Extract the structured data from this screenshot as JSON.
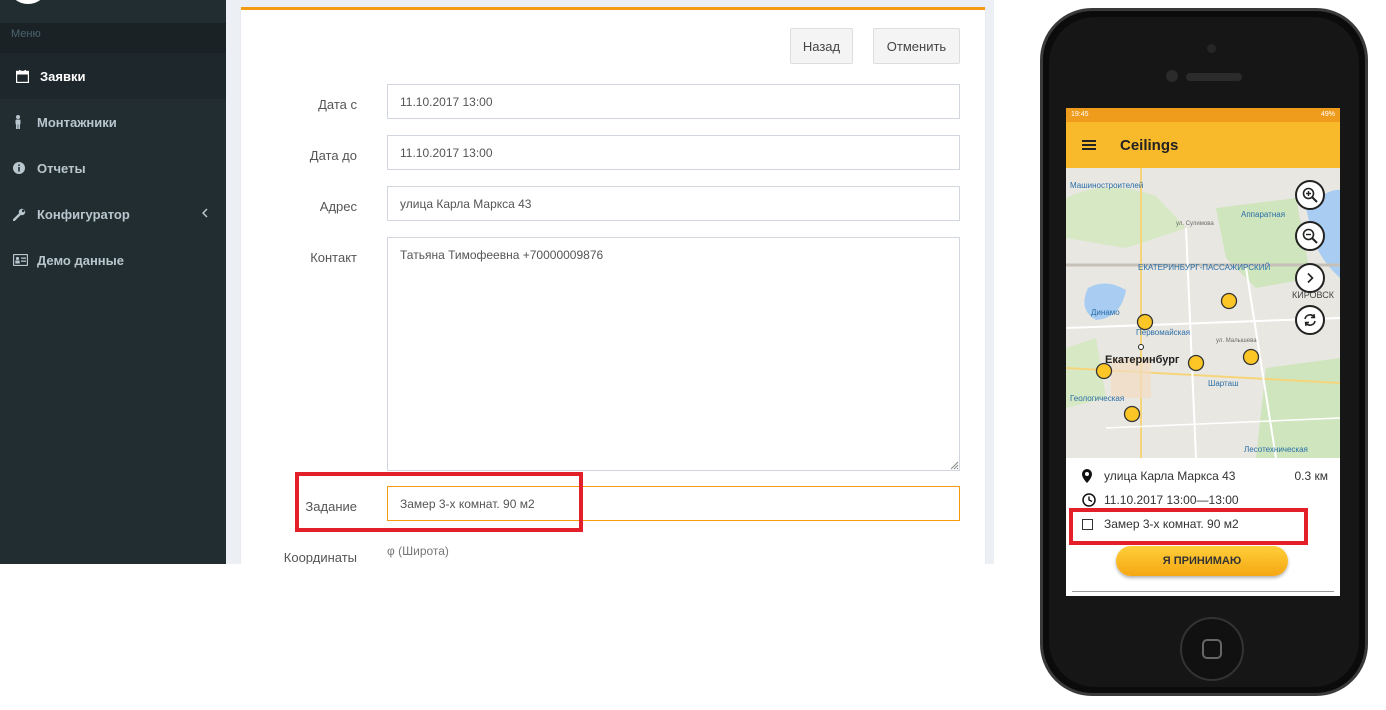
{
  "sidebar": {
    "header": "Меню",
    "items": [
      {
        "label": "Заявки",
        "icon": "calendar-icon"
      },
      {
        "label": "Монтажники",
        "icon": "person-icon"
      },
      {
        "label": "Отчеты",
        "icon": "info-icon"
      },
      {
        "label": "Конфигуратор",
        "icon": "wrench-icon"
      },
      {
        "label": "Демо данные",
        "icon": "id-card-icon"
      }
    ]
  },
  "form": {
    "back_label": "Назад",
    "cancel_label": "Отменить",
    "date_from_label": "Дата с",
    "date_from_value": "11.10.2017 13:00",
    "date_to_label": "Дата до",
    "date_to_value": "11.10.2017 13:00",
    "address_label": "Адрес",
    "address_value": "улица Карла Маркса 43",
    "contact_label": "Контакт",
    "contact_value": "Татьяна Тимофеевна +70000009876",
    "task_label": "Задание",
    "task_value": "Замер 3-х комнат. 90 м2",
    "coords_label": "Координаты",
    "lat_placeholder": "φ (Широта)"
  },
  "phone": {
    "status_time": "19:45",
    "status_battery": "49%",
    "app_title": "Ceilings",
    "map_labels": {
      "mashinostroiteley": "Машиностроителей",
      "apparatnaya": "Аппаратная",
      "station": "ЕКАТЕРИНБУРГ-ПАССАЖИРСКИЙ",
      "kirovsky": "КИРОВСК",
      "dinamo": "Динамо",
      "pervomayskaya": "Первомайская",
      "ekaterinburg": "Екатеринбург",
      "shartash": "Шарташ",
      "geologicheskaya": "Геологическая",
      "lesotekhnicheskaya": "Лесотехническая",
      "sulimova": "ул. Сулимова",
      "malysheva": "ул. Малышева"
    },
    "card": {
      "address": "улица Карла Маркса 43",
      "distance": "0.3 км",
      "time": "11.10.2017 13:00—13:00",
      "task": "Замер 3-х комнат. 90 м2",
      "accept_label": "Я ПРИНИМАЮ"
    }
  },
  "colors": {
    "sidebar_bg": "#222d32",
    "accent": "#f39c12",
    "app_bar": "#f8b92b",
    "highlight": "#e3202a"
  }
}
